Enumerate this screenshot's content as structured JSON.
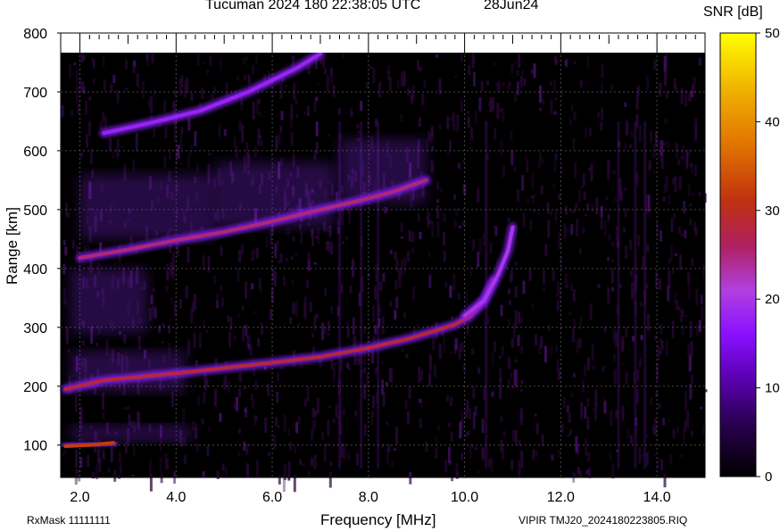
{
  "chart_data": {
    "type": "heatmap",
    "title": "Tucuman 2024 180 22:38:05 UTC",
    "date_label": "28Jun24",
    "xlabel": "Frequency [MHz]",
    "ylabel": "Range [km]",
    "colorbar_label": "SNR [dB]",
    "xlim": [
      1.6,
      15.0
    ],
    "ylim": [
      45,
      800
    ],
    "x_ticks": [
      "2.0",
      "4.0",
      "6.0",
      "8.0",
      "10.0",
      "12.0",
      "14.0"
    ],
    "x_tick_values": [
      2,
      4,
      6,
      8,
      10,
      12,
      14
    ],
    "y_ticks": [
      "100",
      "200",
      "300",
      "400",
      "500",
      "600",
      "700",
      "800"
    ],
    "y_tick_values": [
      100,
      200,
      300,
      400,
      500,
      600,
      700,
      800
    ],
    "colorbar_range": [
      0,
      50
    ],
    "colorbar_ticks": [
      "0",
      "10",
      "20",
      "30",
      "40",
      "50"
    ],
    "colorbar_tick_values": [
      0,
      10,
      20,
      30,
      40,
      50
    ],
    "grid": true,
    "traces": [
      {
        "points": [
          [
            1.7,
            98
          ],
          [
            2.2,
            100
          ],
          [
            2.7,
            104
          ]
        ],
        "snr": 32
      },
      {
        "points": [
          [
            1.7,
            195
          ],
          [
            2.5,
            210
          ],
          [
            4.0,
            222
          ],
          [
            6.0,
            240
          ],
          [
            7.0,
            250
          ],
          [
            8.0,
            265
          ],
          [
            8.8,
            280
          ],
          [
            9.3,
            292
          ],
          [
            9.8,
            305
          ],
          [
            10.1,
            318
          ],
          [
            10.4,
            345
          ],
          [
            10.6,
            380
          ]
        ],
        "snr": 28
      },
      {
        "points": [
          [
            10.0,
            320
          ],
          [
            10.4,
            345
          ],
          [
            10.7,
            390
          ],
          [
            10.9,
            430
          ],
          [
            11.0,
            470
          ]
        ],
        "snr": 20
      },
      {
        "points": [
          [
            2.0,
            418
          ],
          [
            3.0,
            432
          ],
          [
            4.0,
            448
          ],
          [
            5.0,
            462
          ],
          [
            6.0,
            480
          ],
          [
            7.0,
            500
          ],
          [
            7.8,
            515
          ],
          [
            8.5,
            530
          ],
          [
            9.2,
            550
          ]
        ],
        "snr": 25
      },
      {
        "points": [
          [
            2.5,
            630
          ],
          [
            3.5,
            648
          ],
          [
            4.5,
            668
          ],
          [
            5.5,
            700
          ],
          [
            6.5,
            740
          ],
          [
            7.0,
            765
          ]
        ],
        "snr": 18
      }
    ]
  },
  "footer": {
    "rx_mask": "RxMask 11111111",
    "file": "VIPIR  TMJ20_2024180223805.RIQ"
  },
  "colors": {
    "background": "#000000",
    "grid": "#5a5a5a",
    "colormap": [
      "#000000",
      "#3a0066",
      "#8000ff",
      "#c040ff",
      "#b00060",
      "#d04000",
      "#f0a000",
      "#ffff00"
    ]
  }
}
